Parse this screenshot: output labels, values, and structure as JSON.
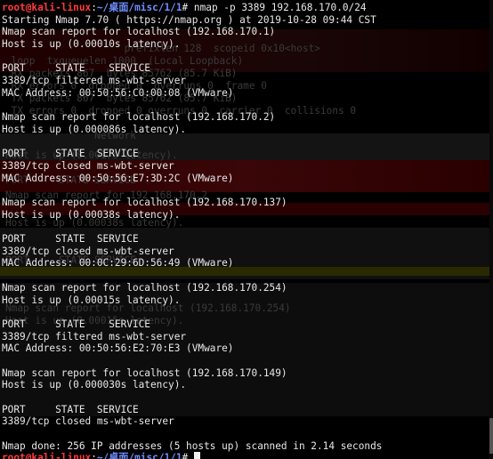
{
  "terminal": {
    "prompt": {
      "user_host": "root@kali-linux",
      "separator": ":",
      "path": "~/桌面/misc/1/1",
      "symbol": "# "
    },
    "command": "nmap -p 3389 192.168.170.0/24",
    "output": [
      "Starting Nmap 7.70 ( https://nmap.org ) at 2019-10-28 09:44 CST",
      "Nmap scan report for localhost (192.168.170.1)",
      "Host is up (0.00010s latency).",
      "",
      "PORT     STATE    SERVICE",
      "3389/tcp filtered ms-wbt-server",
      "MAC Address: 00:50:56:C0:00:08 (VMware)",
      "",
      "Nmap scan report for localhost (192.168.170.2)",
      "Host is up (0.000086s latency).",
      "",
      "PORT     STATE  SERVICE",
      "3389/tcp closed ms-wbt-server",
      "MAC Address: 00:50:56:E7:3D:2C (VMware)",
      "",
      "Nmap scan report for localhost (192.168.170.137)",
      "Host is up (0.00038s latency).",
      "",
      "PORT     STATE  SERVICE",
      "3389/tcp closed ms-wbt-server",
      "MAC Address: 00:0C:29:6D:56:49 (VMware)",
      "",
      "Nmap scan report for localhost (192.168.170.254)",
      "Host is up (0.00015s latency).",
      "",
      "PORT     STATE    SERVICE",
      "3389/tcp filtered ms-wbt-server",
      "MAC Address: 00:50:56:E2:70:E3 (VMware)",
      "",
      "Nmap scan report for localhost (192.168.170.149)",
      "Host is up (0.000030s latency).",
      "",
      "PORT     STATE  SERVICE",
      "3389/tcp closed ms-wbt-server",
      "",
      "Nmap done: 256 IP addresses (5 hosts up) scanned in 2.14 seconds"
    ],
    "ghost_text": [
      "                    prefixlen 128  scopeid 0x10<host>",
      " loop  txqueuelen 1000  (Local Loopback)",
      " RX packets 867  bytes 85762 (85.7 KiB)",
      " RX errors 0  dropped 0  overruns 0  frame 0",
      " TX packets 867  bytes 85762 (85.7 KiB)",
      " TX errors 0  dropped 0 overruns 0  carrier 0  collisions 0",
      "               Network",
      "Host is up (0.0017s latency).",
      "PORT     STATE SERVICE",
      "Nmap scan report for 192.168.170.2",
      "Host is up (0.00038s latency).",
      "PORT     STATE SERVICE",
      "Nmap scan report for localhost (192.168.170.254)",
      "Host is up (0.00015s latency)."
    ],
    "colors": {
      "background": "#000000",
      "text": "#e8e8e8",
      "prompt_user": "#ff3b3b",
      "prompt_path": "#6f8fff"
    }
  }
}
